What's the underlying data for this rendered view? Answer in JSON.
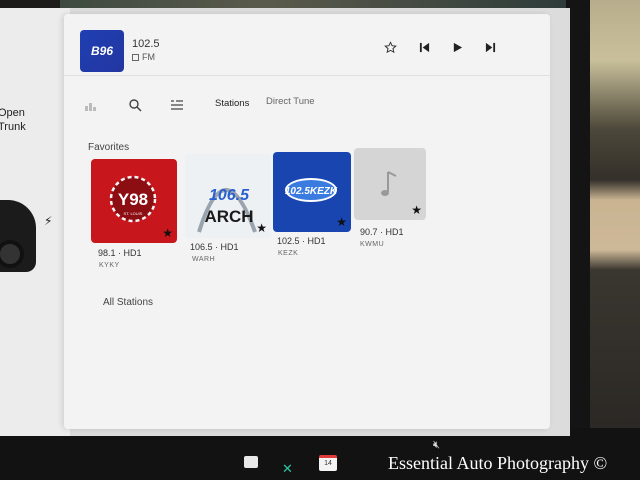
{
  "left_panel": {
    "open_label": "Open",
    "trunk_label": "Trunk"
  },
  "now_playing": {
    "logo_text": "B96",
    "frequency": "102.5",
    "band": "FM"
  },
  "toolbar": {
    "tabs": [
      {
        "label": "Stations",
        "active": true
      },
      {
        "label": "Direct Tune",
        "active": false
      }
    ]
  },
  "favorites": {
    "title": "Favorites",
    "stations": [
      {
        "logo_text": "Y98",
        "logo_subtext": "ST. LOUIS",
        "frequency": "98.1 · HD1",
        "call_sign": "KYKY",
        "starred": true
      },
      {
        "logo_text": "106.5",
        "logo_subtext": "ARCH",
        "frequency": "106.5 · HD1",
        "call_sign": "WARH",
        "starred": true
      },
      {
        "logo_text": "102.5 KEZK",
        "frequency": "102.5 · HD1",
        "call_sign": "KEZK",
        "starred": true
      },
      {
        "logo_text": "",
        "frequency": "90.7 · HD1",
        "call_sign": "KWMU",
        "starred": true
      }
    ]
  },
  "all_stations": {
    "title": "All Stations"
  },
  "taskbar": {
    "calendar_day": "14"
  },
  "watermark": "Essential Auto Photography ©",
  "colors": {
    "y98_red": "#c8161d",
    "kezk_blue": "#1845b0",
    "screen_bg": "#f3f3f3"
  }
}
